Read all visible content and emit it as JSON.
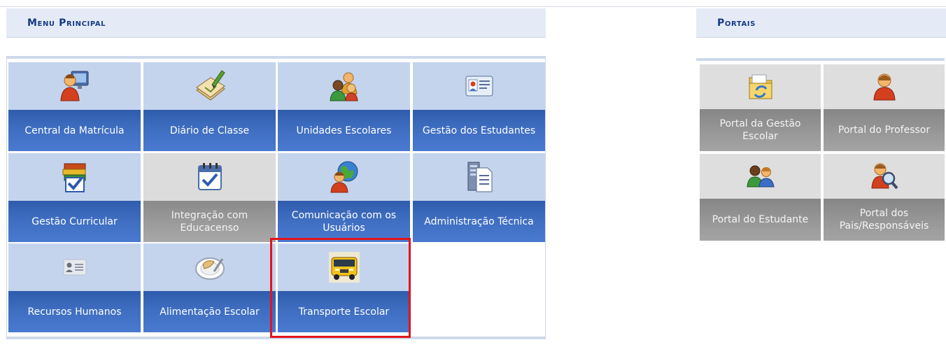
{
  "menu": {
    "title": "Menu Principal",
    "tiles": [
      {
        "label": "Central da Matrícula",
        "icon": "user-computer-icon",
        "enabled": true
      },
      {
        "label": "Diário de Classe",
        "icon": "notebook-pencil-icon",
        "enabled": true
      },
      {
        "label": "Unidades Escolares",
        "icon": "group-users-icon",
        "enabled": true
      },
      {
        "label": "Gestão dos Estudantes",
        "icon": "id-card-icon",
        "enabled": true
      },
      {
        "label": "Gestão Curricular",
        "icon": "books-check-icon",
        "enabled": true
      },
      {
        "label": "Integração com Educacenso",
        "icon": "calendar-check-icon",
        "enabled": false
      },
      {
        "label": "Comunicação com os Usuários",
        "icon": "user-globe-icon",
        "enabled": true
      },
      {
        "label": "Administração Técnica",
        "icon": "server-document-icon",
        "enabled": true
      },
      {
        "label": "Recursos Humanos",
        "icon": "id-badge-icon",
        "enabled": true
      },
      {
        "label": "Alimentação Escolar",
        "icon": "food-plate-icon",
        "enabled": true
      },
      {
        "label": "Transporte Escolar",
        "icon": "school-bus-icon",
        "enabled": true
      }
    ]
  },
  "portals": {
    "title": "Portais",
    "tiles": [
      {
        "label": "Portal da Gestão Escolar",
        "icon": "folder-refresh-icon",
        "enabled": false
      },
      {
        "label": "Portal do Professor",
        "icon": "teacher-icon",
        "enabled": false
      },
      {
        "label": "Portal do Estudante",
        "icon": "students-icon",
        "enabled": false
      },
      {
        "label": "Portal dos Pais/Responsáveis",
        "icon": "user-magnifier-icon",
        "enabled": false
      }
    ]
  },
  "highlight": {
    "target": "Transporte Escolar",
    "color": "#e3141c"
  },
  "colors": {
    "header_text": "#173a84",
    "tile_blue": "#3d6cbf",
    "tile_bg": "#c4d4ed"
  }
}
